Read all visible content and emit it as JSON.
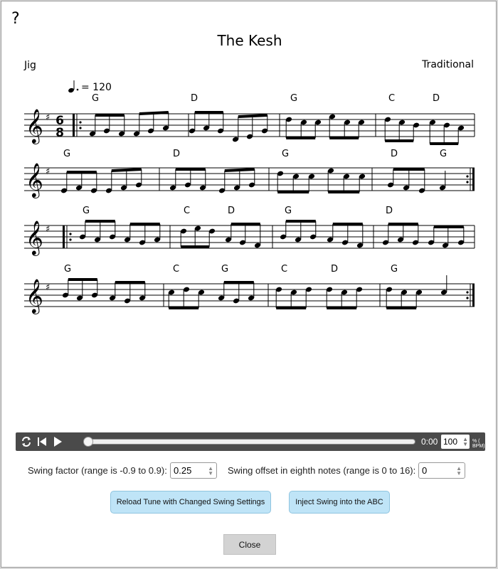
{
  "help": {
    "label": "?"
  },
  "tune": {
    "title": "The Kesh",
    "rhythm": "Jig",
    "composer": "Traditional",
    "tempo_marking": "= 120",
    "time_sig_top": "6",
    "time_sig_bottom": "8",
    "chords": [
      [
        "G",
        "D",
        "G",
        "C",
        "D"
      ],
      [
        "G",
        "D",
        "G",
        "D",
        "G"
      ],
      [
        "G",
        "C",
        "D",
        "G",
        "D"
      ],
      [
        "G",
        "C",
        "G",
        "C",
        "D",
        "G"
      ]
    ]
  },
  "player": {
    "time": "0:00",
    "tempo_percent": "100",
    "tempo_unit": "% ( BPM)",
    "progress": 0
  },
  "swing": {
    "factor_label": "Swing factor (range is -0.9 to 0.9):",
    "factor_value": "0.25",
    "offset_label": "Swing offset in eighth notes (range is 0 to 16):",
    "offset_value": "0"
  },
  "buttons": {
    "reload": "Reload Tune with Changed Swing Settings",
    "inject": "Inject Swing into the ABC",
    "close": "Close"
  }
}
